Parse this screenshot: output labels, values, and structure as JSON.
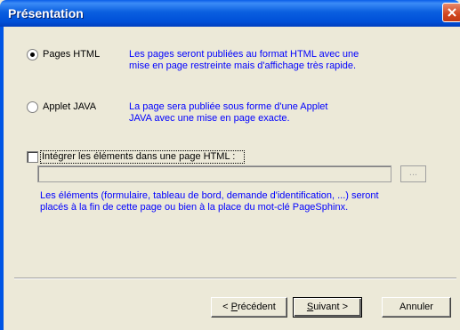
{
  "window": {
    "title": "Présentation"
  },
  "options": {
    "pages_html": {
      "label": "Pages HTML",
      "selected": true,
      "description_line1": "Les pages seront publiées au format HTML avec une",
      "description_line2": "mise en page restreinte mais d'affichage très rapide."
    },
    "applet_java": {
      "label": "Applet JAVA",
      "selected": false,
      "description_line1": "La page sera publiée sous forme d'une Applet",
      "description_line2": "JAVA avec une mise en page exacte."
    }
  },
  "integrate": {
    "label": "Intégrer les éléments dans une page HTML :",
    "checked": false,
    "path_value": "",
    "browse_label": "...",
    "description_line1": "Les éléments (formulaire, tableau de bord, demande d'identification, ...) seront",
    "description_line2": "placés à la fin de cette page ou bien à la place du mot-clé PageSphinx."
  },
  "buttons": {
    "previous_prefix": "< ",
    "previous_mnemonic": "P",
    "previous_rest": "récédent",
    "next_mnemonic": "S",
    "next_rest": "uivant >",
    "cancel": "Annuler"
  },
  "colors": {
    "description_text": "#0000ff",
    "title_bar": "#0a5fe0",
    "dialog_background": "#ece9d8"
  }
}
